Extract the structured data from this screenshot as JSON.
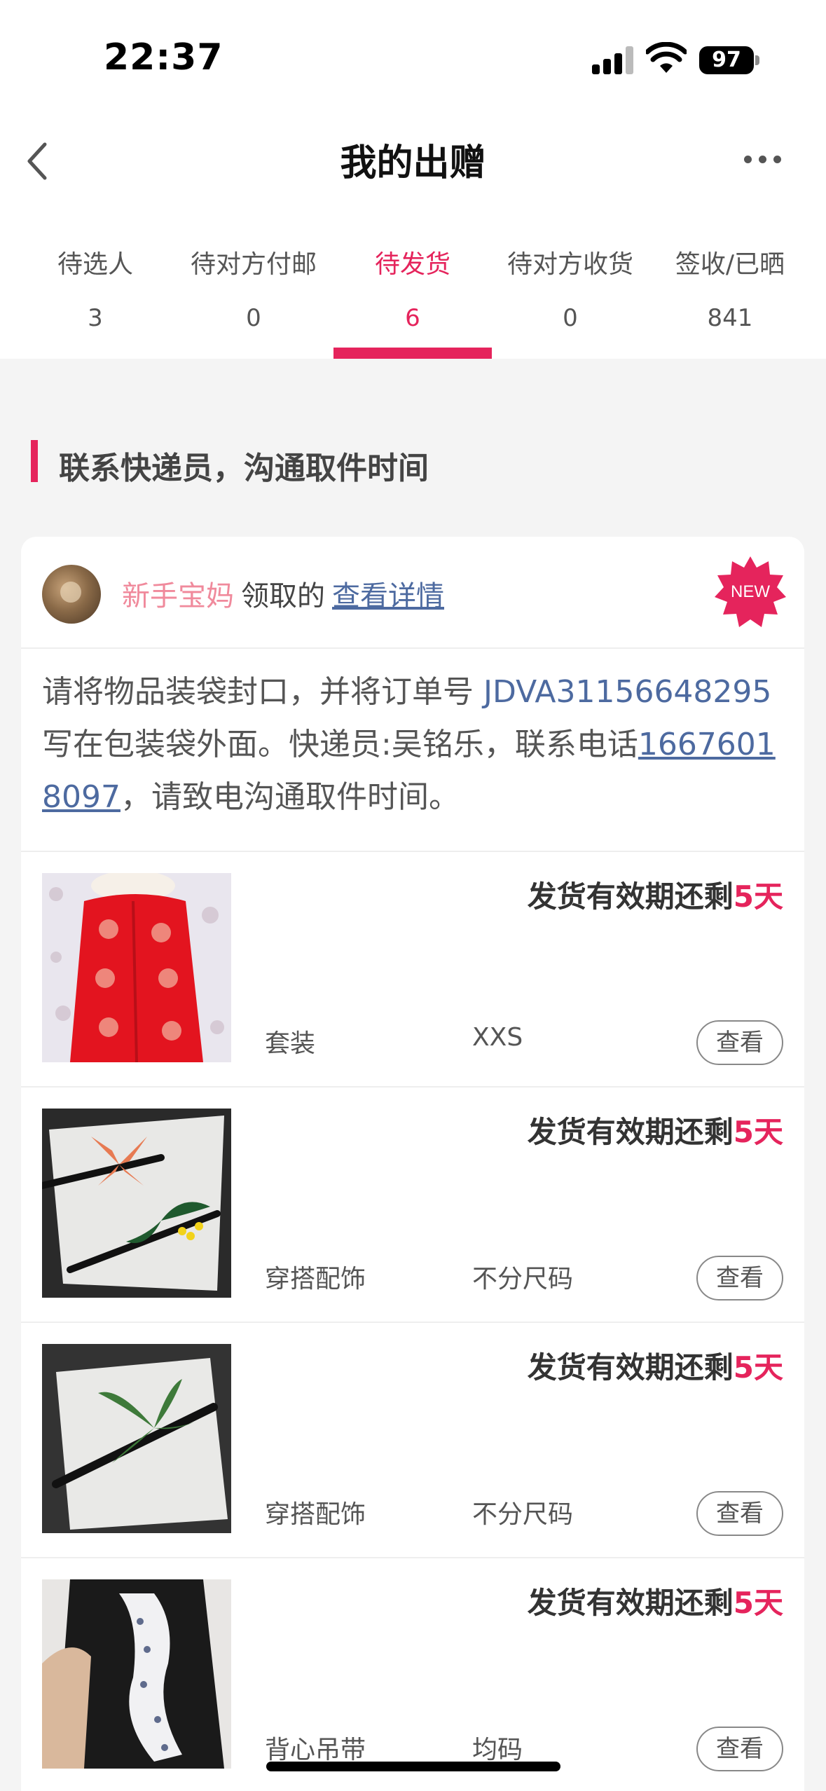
{
  "status_bar": {
    "time": "22:37",
    "battery": "97"
  },
  "nav": {
    "title": "我的出赠",
    "back_icon": "chevron-left-icon",
    "more_icon": "more-dots-icon"
  },
  "tabs": [
    {
      "label": "待选人",
      "count": "3"
    },
    {
      "label": "待对方付邮",
      "count": "0"
    },
    {
      "label": "待发货",
      "count": "6",
      "active": true
    },
    {
      "label": "待对方收货",
      "count": "0"
    },
    {
      "label": "签收/已晒",
      "count": "841"
    }
  ],
  "section": {
    "title": "联系快递员，沟通取件时间"
  },
  "order": {
    "user_name": "新手宝妈",
    "claim_text": "领取的",
    "detail_link": "查看详情",
    "new_badge": "NEW",
    "notice": {
      "prefix": "请将物品装袋封口，并将订单号 ",
      "order_number": "JDVA31156648295",
      "middle": " 写在包装袋外面。快递员:吴铭乐，联系电话",
      "phone": "16676018097",
      "suffix": "，请致电沟通取件时间。"
    }
  },
  "items": [
    {
      "deadline_prefix": "发货有效期还剩",
      "days": "5天",
      "category": "套装",
      "size": "XXS",
      "button": "查看",
      "image": "red-padded-outfit"
    },
    {
      "deadline_prefix": "发货有效期还剩",
      "days": "5天",
      "category": "穿搭配饰",
      "size": "不分尺码",
      "button": "查看",
      "image": "flower-hairpins"
    },
    {
      "deadline_prefix": "发货有效期还剩",
      "days": "5天",
      "category": "穿搭配饰",
      "size": "不分尺码",
      "button": "查看",
      "image": "leaf-hairpin"
    },
    {
      "deadline_prefix": "发货有效期还剩",
      "days": "5天",
      "category": "背心吊带",
      "size": "均码",
      "button": "查看",
      "image": "silk-scarf"
    }
  ],
  "colors": {
    "accent": "#e5245c",
    "link": "#4d6aa0",
    "user_name": "#f08a9c"
  }
}
